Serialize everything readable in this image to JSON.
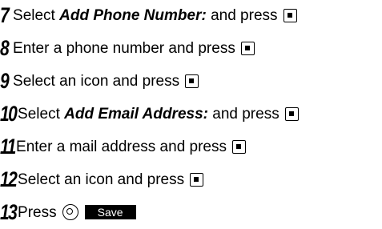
{
  "steps": [
    {
      "number": "7",
      "text_before": "Select ",
      "emphasis": "Add Phone Number:",
      "text_after": " and press",
      "key_icon": "center-key-icon"
    },
    {
      "number": "8",
      "text_before": "Enter a phone number and press",
      "emphasis": "",
      "text_after": "",
      "key_icon": "center-key-icon"
    },
    {
      "number": "9",
      "text_before": "Select an icon and press",
      "emphasis": "",
      "text_after": "",
      "key_icon": "center-key-icon"
    },
    {
      "number": "10",
      "text_before": "Select ",
      "emphasis": "Add Email Address:",
      "text_after": " and press",
      "key_icon": "center-key-icon"
    },
    {
      "number": "11",
      "text_before": "Enter a mail address and press",
      "emphasis": "",
      "text_after": "",
      "key_icon": "center-key-icon"
    },
    {
      "number": "12",
      "text_before": "Select an icon and press",
      "emphasis": "",
      "text_after": "",
      "key_icon": "center-key-icon"
    },
    {
      "number": "13",
      "text_before": "Press",
      "emphasis": "",
      "text_after": "",
      "key_icon": "soft-key-icon",
      "softkey_label": "Save"
    }
  ]
}
